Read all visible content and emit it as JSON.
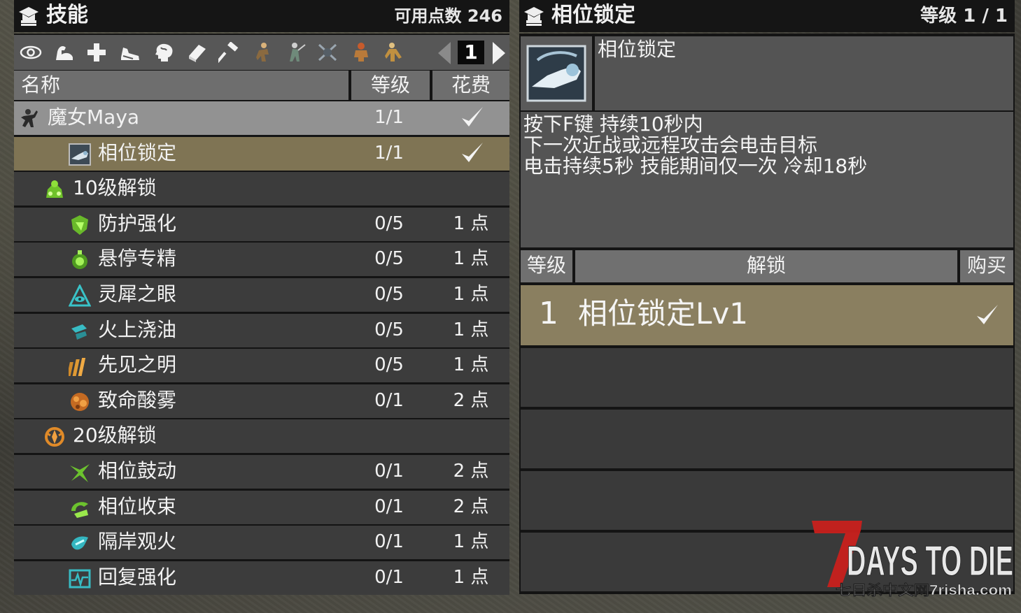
{
  "left_panel": {
    "title": "技能",
    "points_label": "可用点数 246",
    "page": "1",
    "columns": {
      "name": "名称",
      "level": "等级",
      "cost": "花费"
    },
    "category_icons": [
      "eye-icon",
      "arm-icon",
      "plus-icon",
      "running-shoe-icon",
      "brain-icon",
      "book-icon",
      "hammer-icon",
      "character-1-icon",
      "character-2-icon",
      "character-3-icon",
      "character-4-icon",
      "character-5-icon"
    ],
    "rows": [
      {
        "name": "魔女Maya",
        "level": "1/1",
        "cost": "",
        "checked": true,
        "state": "highlight",
        "icon": "maya-portrait-icon"
      },
      {
        "name": "相位锁定",
        "level": "1/1",
        "cost": "",
        "checked": true,
        "state": "selected",
        "icon": "phase-lock-icon"
      },
      {
        "name": "10级解锁",
        "level": "",
        "cost": "",
        "checked": false,
        "state": "group",
        "icon": "unlock-10-icon"
      },
      {
        "name": "防护强化",
        "level": "0/5",
        "cost": "1 点",
        "checked": false,
        "state": "normal",
        "icon": "shield-icon"
      },
      {
        "name": "悬停专精",
        "level": "0/5",
        "cost": "1 点",
        "checked": false,
        "state": "normal",
        "icon": "hover-icon"
      },
      {
        "name": "灵犀之眼",
        "level": "0/5",
        "cost": "1 点",
        "checked": false,
        "state": "normal",
        "icon": "eye-triangle-icon"
      },
      {
        "name": "火上浇油",
        "level": "0/5",
        "cost": "1 点",
        "checked": false,
        "state": "normal",
        "icon": "fire-oil-icon"
      },
      {
        "name": "先见之明",
        "level": "0/5",
        "cost": "1 点",
        "checked": false,
        "state": "normal",
        "icon": "foresight-icon"
      },
      {
        "name": "致命酸雾",
        "level": "0/1",
        "cost": "2 点",
        "checked": false,
        "state": "normal",
        "icon": "acid-fog-icon"
      },
      {
        "name": "20级解锁",
        "level": "",
        "cost": "",
        "checked": false,
        "state": "group",
        "icon": "unlock-20-icon"
      },
      {
        "name": "相位鼓动",
        "level": "0/1",
        "cost": "2 点",
        "checked": false,
        "state": "normal",
        "icon": "phase-drum-icon"
      },
      {
        "name": "相位收束",
        "level": "0/1",
        "cost": "2 点",
        "checked": false,
        "state": "normal",
        "icon": "phase-converge-icon"
      },
      {
        "name": "隔岸观火",
        "level": "0/1",
        "cost": "1 点",
        "checked": false,
        "state": "normal",
        "icon": "watch-fire-icon"
      },
      {
        "name": "回复强化",
        "level": "0/1",
        "cost": "1 点",
        "checked": false,
        "state": "normal",
        "icon": "heal-boost-icon"
      }
    ]
  },
  "right_panel": {
    "title": "相位锁定",
    "level_label": "等级 1 / 1",
    "skill_name": "相位锁定",
    "description": [
      "按下F键 持续10秒内",
      "下一次近战或远程攻击会电击目标",
      "电击持续5秒 技能期间仅一次 冷却18秒"
    ],
    "unlock_columns": {
      "level": "等级",
      "unlock": "解锁",
      "buy": "购买"
    },
    "unlock_rows": [
      {
        "level": "1",
        "name": "相位锁定Lv1",
        "purchased": true
      }
    ]
  },
  "logo": {
    "title": "DAYS TO DIE",
    "numeral": "7",
    "watermark": "七日杀中文网7risha.com"
  },
  "colors": {
    "selected_row": "#7f7454",
    "highlight_row": "#929292",
    "row_bg": "#3c3c3c",
    "header_bg": "#151515",
    "logo_red": "#c8201c",
    "icon_green": "#7bd42c"
  }
}
